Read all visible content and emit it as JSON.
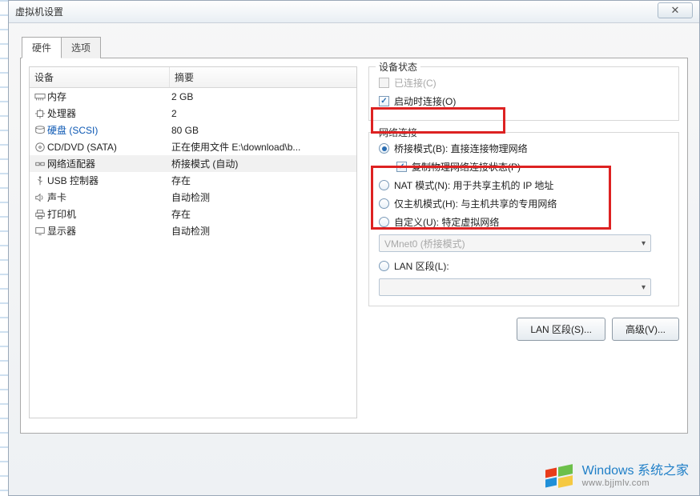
{
  "window": {
    "title": "虚拟机设置",
    "close_glyph": "✕"
  },
  "tabs": {
    "hardware": "硬件",
    "options": "选项"
  },
  "list_header": {
    "device": "设备",
    "summary": "摘要"
  },
  "devices": [
    {
      "icon": "memory",
      "name": "内存",
      "summary": "2 GB"
    },
    {
      "icon": "cpu",
      "name": "处理器",
      "summary": "2"
    },
    {
      "icon": "disk",
      "name": "硬盘 (SCSI)",
      "summary": "80 GB",
      "scsi": true
    },
    {
      "icon": "cd",
      "name": "CD/DVD (SATA)",
      "summary": "正在使用文件 E:\\download\\b..."
    },
    {
      "icon": "net",
      "name": "网络适配器",
      "summary": "桥接模式 (自动)",
      "selected": true
    },
    {
      "icon": "usb",
      "name": "USB 控制器",
      "summary": "存在"
    },
    {
      "icon": "sound",
      "name": "声卡",
      "summary": "自动检测"
    },
    {
      "icon": "printer",
      "name": "打印机",
      "summary": "存在"
    },
    {
      "icon": "display",
      "name": "显示器",
      "summary": "自动检测"
    }
  ],
  "device_state": {
    "legend": "设备状态",
    "connected": "已连接(C)",
    "connect_on_start": "启动时连接(O)"
  },
  "network": {
    "legend": "网络连接",
    "bridged": "桥接模式(B): 直接连接物理网络",
    "replicate": "复制物理网络连接状态(P)",
    "nat": "NAT 模式(N): 用于共享主机的 IP 地址",
    "hostonly": "仅主机模式(H): 与主机共享的专用网络",
    "custom": "自定义(U): 特定虚拟网络",
    "custom_selected": "VMnet0 (桥接模式)",
    "lan_segment": "LAN 区段(L):"
  },
  "buttons": {
    "lan_segments": "LAN 区段(S)...",
    "advanced": "高级(V)..."
  },
  "watermark": {
    "main": "Windows 系统之家",
    "sub": "www.bjjmlv.com"
  }
}
